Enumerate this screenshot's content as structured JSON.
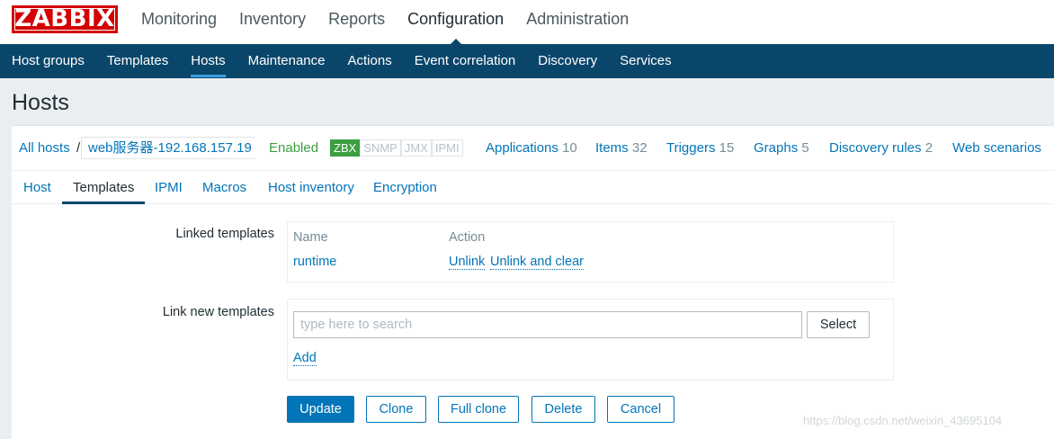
{
  "logo": "ZABBIX",
  "topnav": [
    "Monitoring",
    "Inventory",
    "Reports",
    "Configuration",
    "Administration"
  ],
  "subnav": [
    "Host groups",
    "Templates",
    "Hosts",
    "Maintenance",
    "Actions",
    "Event correlation",
    "Discovery",
    "Services"
  ],
  "page_title": "Hosts",
  "host_strip": {
    "all_hosts": "All hosts",
    "separator": "/",
    "host_name": "web服务器-192.168.157.19",
    "status": "Enabled",
    "badges": [
      "ZBX",
      "SNMP",
      "JMX",
      "IPMI"
    ],
    "applications": {
      "label": "Applications",
      "count": "10"
    },
    "items": {
      "label": "Items",
      "count": "32"
    },
    "triggers": {
      "label": "Triggers",
      "count": "15"
    },
    "graphs": {
      "label": "Graphs",
      "count": "5"
    },
    "discovery_rules": {
      "label": "Discovery rules",
      "count": "2"
    },
    "web_scenarios": {
      "label": "Web scenarios"
    }
  },
  "tabs": [
    "Host",
    "Templates",
    "IPMI",
    "Macros",
    "Host inventory",
    "Encryption"
  ],
  "form": {
    "linked_templates_label": "Linked templates",
    "col_name": "Name",
    "col_action": "Action",
    "template_name": "runtime",
    "unlink": "Unlink",
    "unlink_clear": "Unlink and clear",
    "link_new_label": "Link new templates",
    "search_placeholder": "type here to search",
    "select": "Select",
    "add": "Add"
  },
  "buttons": {
    "update": "Update",
    "clone": "Clone",
    "full_clone": "Full clone",
    "delete": "Delete",
    "cancel": "Cancel"
  },
  "watermark": "https://blog.csdn.net/weixin_43695104",
  "colors": {
    "brand": "#d40000",
    "subnav_bg": "#0a466a",
    "link": "#0275b8",
    "enabled": "#3d9e42"
  }
}
